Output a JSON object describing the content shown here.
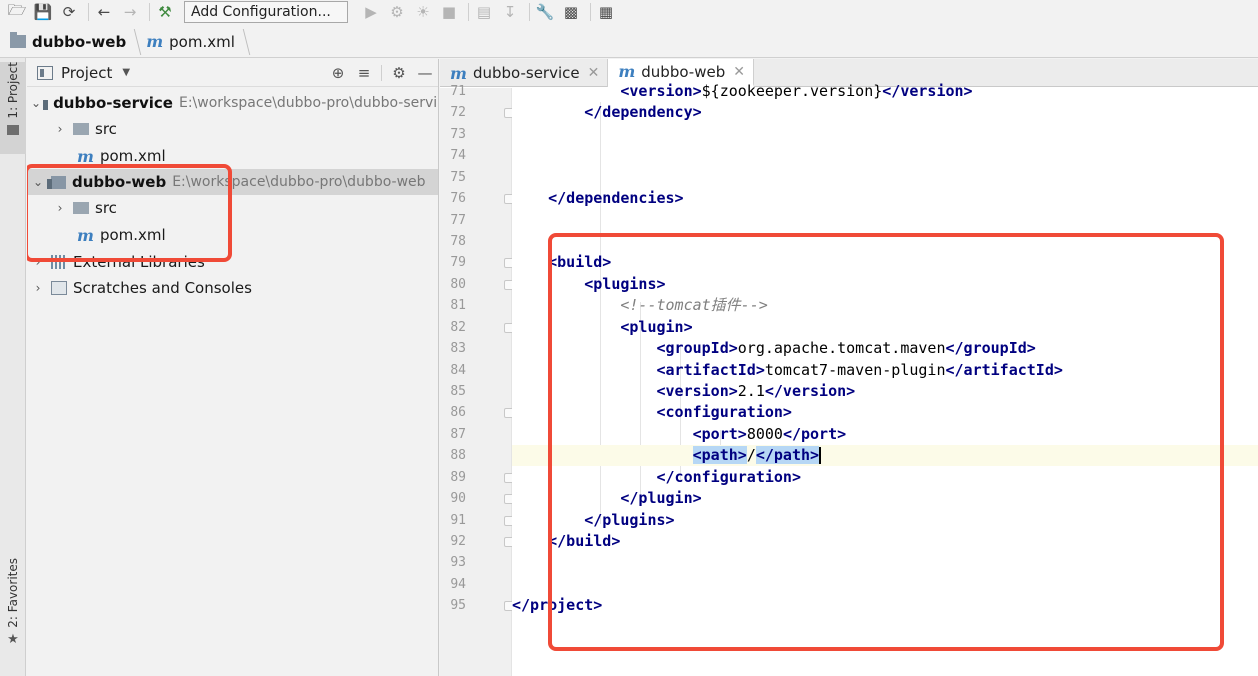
{
  "toolbar": {
    "run_config": "Add Configuration..."
  },
  "breadcrumb": {
    "project": "dubbo-web",
    "file": "pom.xml"
  },
  "left_stripe": {
    "project_tab": "1: Project",
    "favorites_tab": "2: Favorites"
  },
  "project_panel": {
    "title": "Project",
    "tree": [
      {
        "label": "dubbo-service",
        "path": "E:\\workspace\\dubbo-pro\\dubbo-service"
      },
      {
        "label": "src"
      },
      {
        "label": "pom.xml"
      },
      {
        "label": "dubbo-web",
        "path": "E:\\workspace\\dubbo-pro\\dubbo-web"
      },
      {
        "label": "src"
      },
      {
        "label": "pom.xml"
      },
      {
        "label": "External Libraries"
      },
      {
        "label": "Scratches and Consoles"
      }
    ]
  },
  "editor": {
    "tabs": [
      {
        "label": "dubbo-service"
      },
      {
        "label": "dubbo-web"
      }
    ],
    "line_numbers": [
      "71",
      "72",
      "73",
      "74",
      "75",
      "76",
      "77",
      "78",
      "79",
      "80",
      "81",
      "82",
      "83",
      "84",
      "85",
      "86",
      "87",
      "88",
      "89",
      "90",
      "91",
      "92",
      "93",
      "94",
      "95"
    ],
    "code": {
      "l71_text": "${zookeeper.version}",
      "l83_text": "org.apache.tomcat.maven",
      "l84_text": "tomcat7-maven-plugin",
      "l85_text": "2.1",
      "l87_text": "8000",
      "l88_text": "/",
      "comment": "<!--tomcat插件-->"
    }
  },
  "colors": {
    "annotation": "#f04a37",
    "xml_tag": "#000080",
    "comment": "#808080"
  }
}
